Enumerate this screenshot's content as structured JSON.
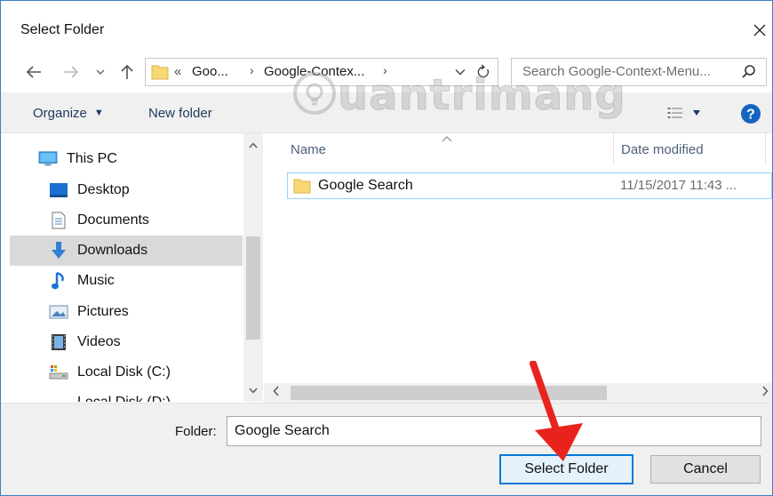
{
  "window": {
    "title": "Select Folder",
    "close_icon": "close-icon"
  },
  "address": {
    "overflow": "«",
    "crumbs": [
      "Goo...",
      "Google-Contex..."
    ],
    "separator": "›"
  },
  "search": {
    "placeholder": "Search Google-Context-Menu..."
  },
  "toolbar": {
    "organize_label": "Organize",
    "new_folder_label": "New folder"
  },
  "watermark": {
    "text": "uantrimang"
  },
  "nav": {
    "items": [
      {
        "label": "This PC",
        "icon": "pc-icon"
      },
      {
        "label": "Desktop",
        "icon": "desktop-icon"
      },
      {
        "label": "Documents",
        "icon": "documents-icon"
      },
      {
        "label": "Downloads",
        "icon": "downloads-icon"
      },
      {
        "label": "Music",
        "icon": "music-icon"
      },
      {
        "label": "Pictures",
        "icon": "pictures-icon"
      },
      {
        "label": "Videos",
        "icon": "videos-icon"
      },
      {
        "label": "Local Disk (C:)",
        "icon": "disk-icon"
      },
      {
        "label": "Local Disk (D:)",
        "icon": "disk-icon"
      }
    ],
    "selected": "Downloads"
  },
  "filelist": {
    "columns": [
      "Name",
      "Date modified"
    ],
    "rows": [
      {
        "name": "Google Search",
        "date": "11/15/2017 11:43 ..."
      }
    ]
  },
  "footer": {
    "folder_label": "Folder:",
    "folder_value": "Google Search",
    "select_label": "Select Folder",
    "cancel_label": "Cancel"
  },
  "colors": {
    "accent": "#0078d7",
    "selection_border": "#99d1ff",
    "nav_selected": "#d9d9d9",
    "annotation": "#e8231e"
  }
}
